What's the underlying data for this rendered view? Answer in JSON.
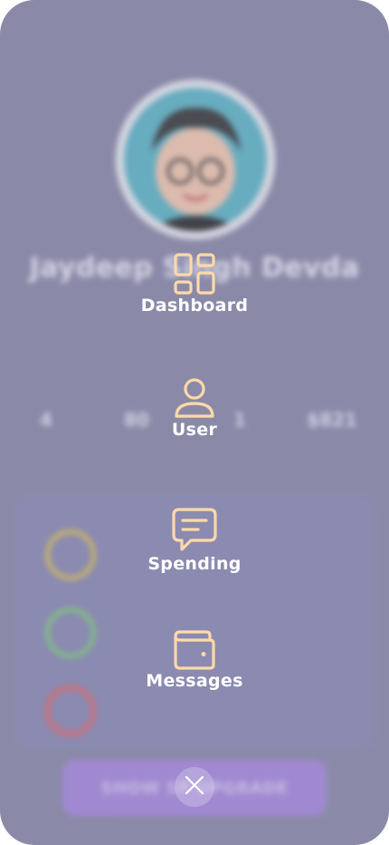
{
  "profile": {
    "name": "Jaydeep Singh Devda"
  },
  "stats": [
    {
      "value": "4"
    },
    {
      "value": "80"
    },
    {
      "value": "1"
    },
    {
      "value": "$821"
    }
  ],
  "rings": [
    {
      "color": "#d9c35a"
    },
    {
      "color": "#7fce7a"
    },
    {
      "color": "#e46a6a"
    }
  ],
  "cta": {
    "label": "SHOW SP    UPGRADE"
  },
  "menu": {
    "items": [
      {
        "label": "Dashboard",
        "icon": "dashboard-icon"
      },
      {
        "label": "User",
        "icon": "user-icon"
      },
      {
        "label": "Spending",
        "icon": "message-icon"
      },
      {
        "label": "Messages",
        "icon": "wallet-icon"
      }
    ],
    "icon_color": "#ffd9a8",
    "close_icon": "close-icon"
  }
}
